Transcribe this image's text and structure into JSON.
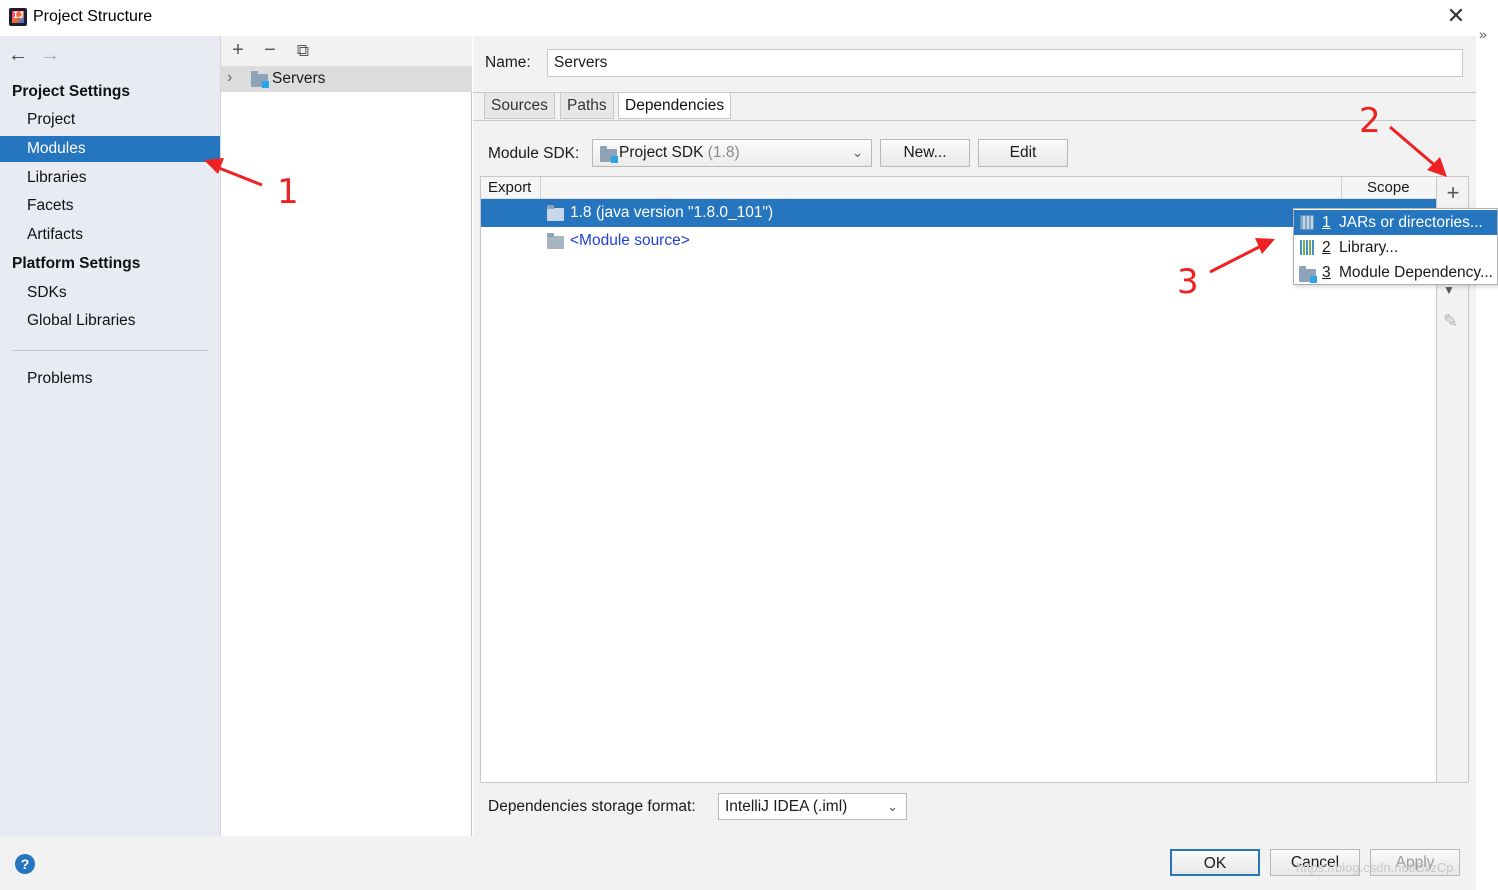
{
  "window": {
    "title": "Project Structure",
    "close_glyph": "✕"
  },
  "nav": {
    "back_glyph": "←",
    "forward_glyph": "→",
    "project_settings_header": "Project Settings",
    "project_items": [
      "Project",
      "Modules",
      "Libraries",
      "Facets",
      "Artifacts"
    ],
    "selected_item": "Modules",
    "platform_settings_header": "Platform Settings",
    "platform_items": [
      "SDKs",
      "Global Libraries"
    ],
    "problems": "Problems"
  },
  "module_list": {
    "add_glyph": "+",
    "remove_glyph": "−",
    "copy_glyph": "⧉",
    "chevron": "›",
    "module_name": "Servers"
  },
  "detail": {
    "name_label": "Name:",
    "name_value": "Servers",
    "tabs": [
      "Sources",
      "Paths",
      "Dependencies"
    ],
    "active_tab": "Dependencies",
    "module_sdk_label": "Module SDK:",
    "sdk_value": "Project SDK",
    "sdk_version": "(1.8)",
    "dropdown_glyph": "⌄",
    "new_button": "New...",
    "edit_button": "Edit",
    "table_headers": {
      "export": "Export",
      "scope": "Scope"
    },
    "dependencies": [
      {
        "label": "1.8 (java version \"1.8.0_101\")",
        "selected": true
      },
      {
        "label": "<Module source>",
        "selected": false
      }
    ],
    "add_dependency_glyph": "+",
    "down_glyph": "▼",
    "edit_glyph": "✎",
    "storage_label": "Dependencies storage format:",
    "storage_value": "IntelliJ IDEA (.iml)"
  },
  "add_menu": {
    "items": [
      {
        "num": "1",
        "label": "JARs or directories...",
        "icon": "jar-icon",
        "selected": true
      },
      {
        "num": "2",
        "label": "Library...",
        "icon": "library-icon",
        "selected": false
      },
      {
        "num": "3",
        "label": "Module Dependency...",
        "icon": "module-icon",
        "selected": false
      }
    ]
  },
  "footer": {
    "help_glyph": "?",
    "ok": "OK",
    "cancel": "Cancel",
    "apply": "Apply",
    "watermark": "https://blog.csdn.net/BlizCp"
  },
  "edge": {
    "chevron": "»"
  },
  "annotations": {
    "color": "#ee2222",
    "labels": [
      "1",
      "2",
      "3"
    ]
  },
  "colors": {
    "selection": "#2675bf",
    "link": "#2040d0",
    "nav_bg": "#e8ecf2"
  }
}
